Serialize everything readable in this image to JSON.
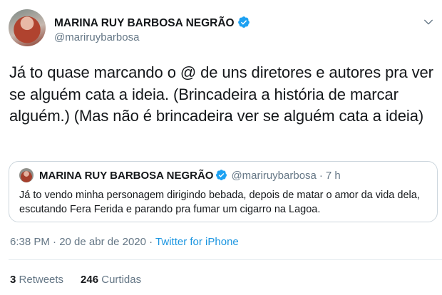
{
  "author": {
    "name": "MARINA RUY BARBOSA NEGRÃO",
    "handle": "@mariruybarbosa",
    "verified": true
  },
  "tweet": {
    "text": "Já to quase marcando o @ de uns diretores e autores pra ver se alguém cata a ideia. (Brincadeira a história de marcar alguém.) (Mas não é brincadeira ver se alguém cata a ideia)"
  },
  "quoted": {
    "name": "MARINA RUY BARBOSA NEGRÃO",
    "handle": "@mariruybarbosa",
    "separator": "·",
    "time": "7 h",
    "text": "Já to vendo minha personagem dirigindo bebada, depois de matar o amor da vida dela, escutando Fera Ferida e parando pra fumar um cigarro na Lagoa."
  },
  "meta": {
    "timestamp": "6:38 PM · 20 de abr de 2020 · ",
    "source": "Twitter for iPhone"
  },
  "stats": {
    "retweets_count": "3",
    "retweets_label": "Retweets",
    "likes_count": "246",
    "likes_label": "Curtidas"
  },
  "colors": {
    "accent": "#1da1f2",
    "link": "#1b95e0",
    "muted": "#657786",
    "border": "#ccd6dd"
  },
  "icons": {
    "verified": "verified-badge-icon",
    "more": "chevron-down-icon"
  }
}
